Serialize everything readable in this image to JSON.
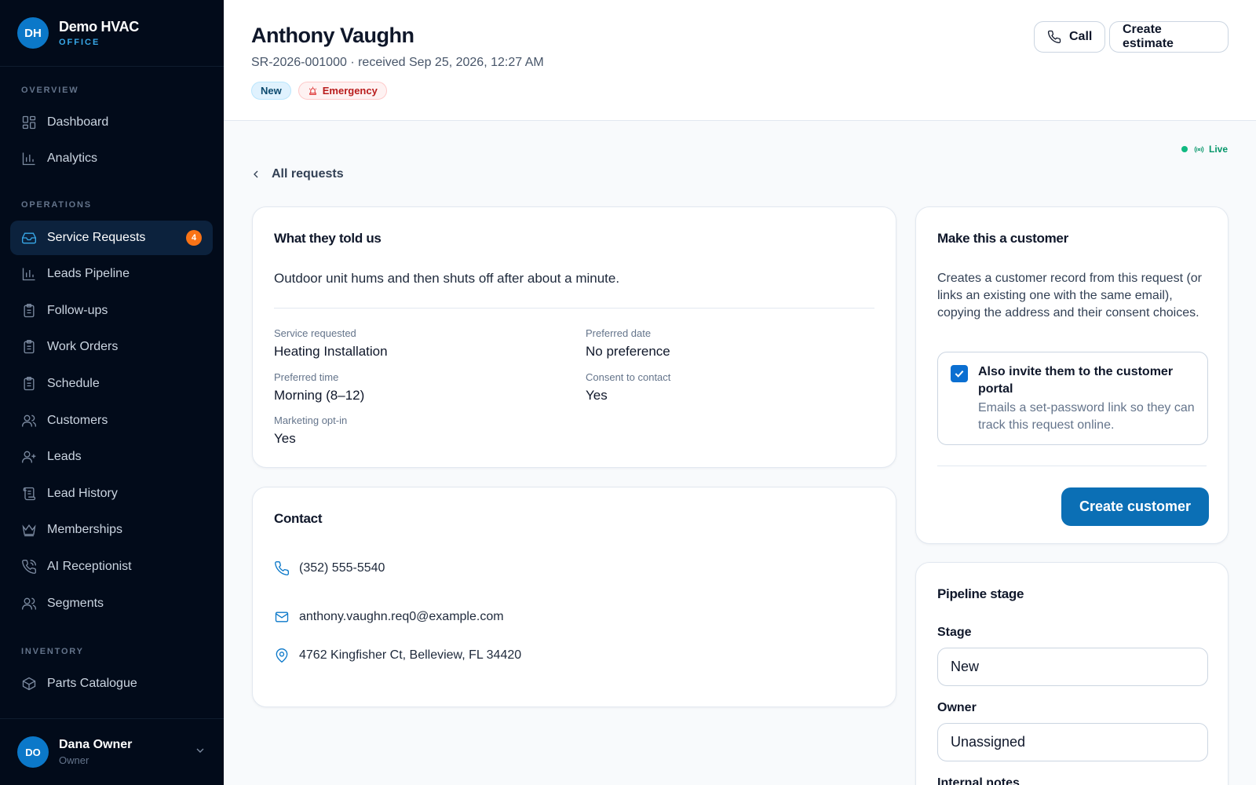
{
  "app": {
    "logo_initials": "DH",
    "name": "Demo HVAC",
    "subtitle": "OFFICE"
  },
  "sidebar": {
    "sections": [
      {
        "label": "OVERVIEW"
      },
      {
        "label": "OPERATIONS"
      },
      {
        "label": "INVENTORY"
      }
    ],
    "items": [
      {
        "label": "Dashboard",
        "icon": "grid-icon"
      },
      {
        "label": "Analytics",
        "icon": "bar-chart-icon"
      },
      {
        "label": "Service Requests",
        "icon": "inbox-icon",
        "badge": "4",
        "active": true
      },
      {
        "label": "Leads Pipeline",
        "icon": "bar-chart-icon"
      },
      {
        "label": "Follow-ups",
        "icon": "clipboard-icon"
      },
      {
        "label": "Work Orders",
        "icon": "clipboard-icon"
      },
      {
        "label": "Schedule",
        "icon": "clipboard-icon"
      },
      {
        "label": "Customers",
        "icon": "users-icon"
      },
      {
        "label": "Leads",
        "icon": "user-plus-icon"
      },
      {
        "label": "Lead History",
        "icon": "scroll-icon"
      },
      {
        "label": "Memberships",
        "icon": "crown-icon"
      },
      {
        "label": "AI Receptionist",
        "icon": "phone-call-icon"
      },
      {
        "label": "Segments",
        "icon": "users-icon"
      },
      {
        "label": "Parts Catalogue",
        "icon": "package-icon"
      }
    ]
  },
  "user": {
    "initials": "DO",
    "name": "Dana Owner",
    "role": "Owner"
  },
  "header": {
    "title": "Anthony Vaughn",
    "subtitle": "SR-2026-001000 · received Sep 25, 2026, 12:27 AM",
    "badge_status": "New",
    "badge_priority": "Emergency",
    "call_label": "Call",
    "estimate_label": "Create estimate"
  },
  "live_label": "Live",
  "back_label": "All requests",
  "told": {
    "title": "What they told us",
    "message": "Outdoor unit hums and then shuts off after about a minute.",
    "fields": [
      {
        "label": "Service requested",
        "value": "Heating Installation"
      },
      {
        "label": "Preferred date",
        "value": "No preference"
      },
      {
        "label": "Preferred time",
        "value": "Morning (8–12)"
      },
      {
        "label": "Consent to contact",
        "value": "Yes"
      },
      {
        "label": "Marketing opt-in",
        "value": "Yes"
      }
    ]
  },
  "contact": {
    "title": "Contact",
    "phone": "(352) 555-5540",
    "email": "anthony.vaughn.req0@example.com",
    "address": "4762 Kingfisher Ct, Belleview, FL 34420"
  },
  "customer_card": {
    "title": "Make this a customer",
    "description": "Creates a customer record from this request (or links an existing one with the same email), copying the address and their consent choices.",
    "invite_checked": true,
    "invite_title": "Also invite them to the customer portal",
    "invite_desc": "Emails a set-password link so they can track this request online.",
    "button_label": "Create customer"
  },
  "pipeline": {
    "title": "Pipeline stage",
    "stage_label": "Stage",
    "stage_value": "New",
    "owner_label": "Owner",
    "owner_value": "Unassigned",
    "notes_label": "Internal notes"
  },
  "colors": {
    "sidebar_bg": "#020b1a",
    "accent": "#0b78c9",
    "primary_button": "#0b6fb5",
    "badge_orange": "#f97316",
    "live_green": "#10b981"
  }
}
